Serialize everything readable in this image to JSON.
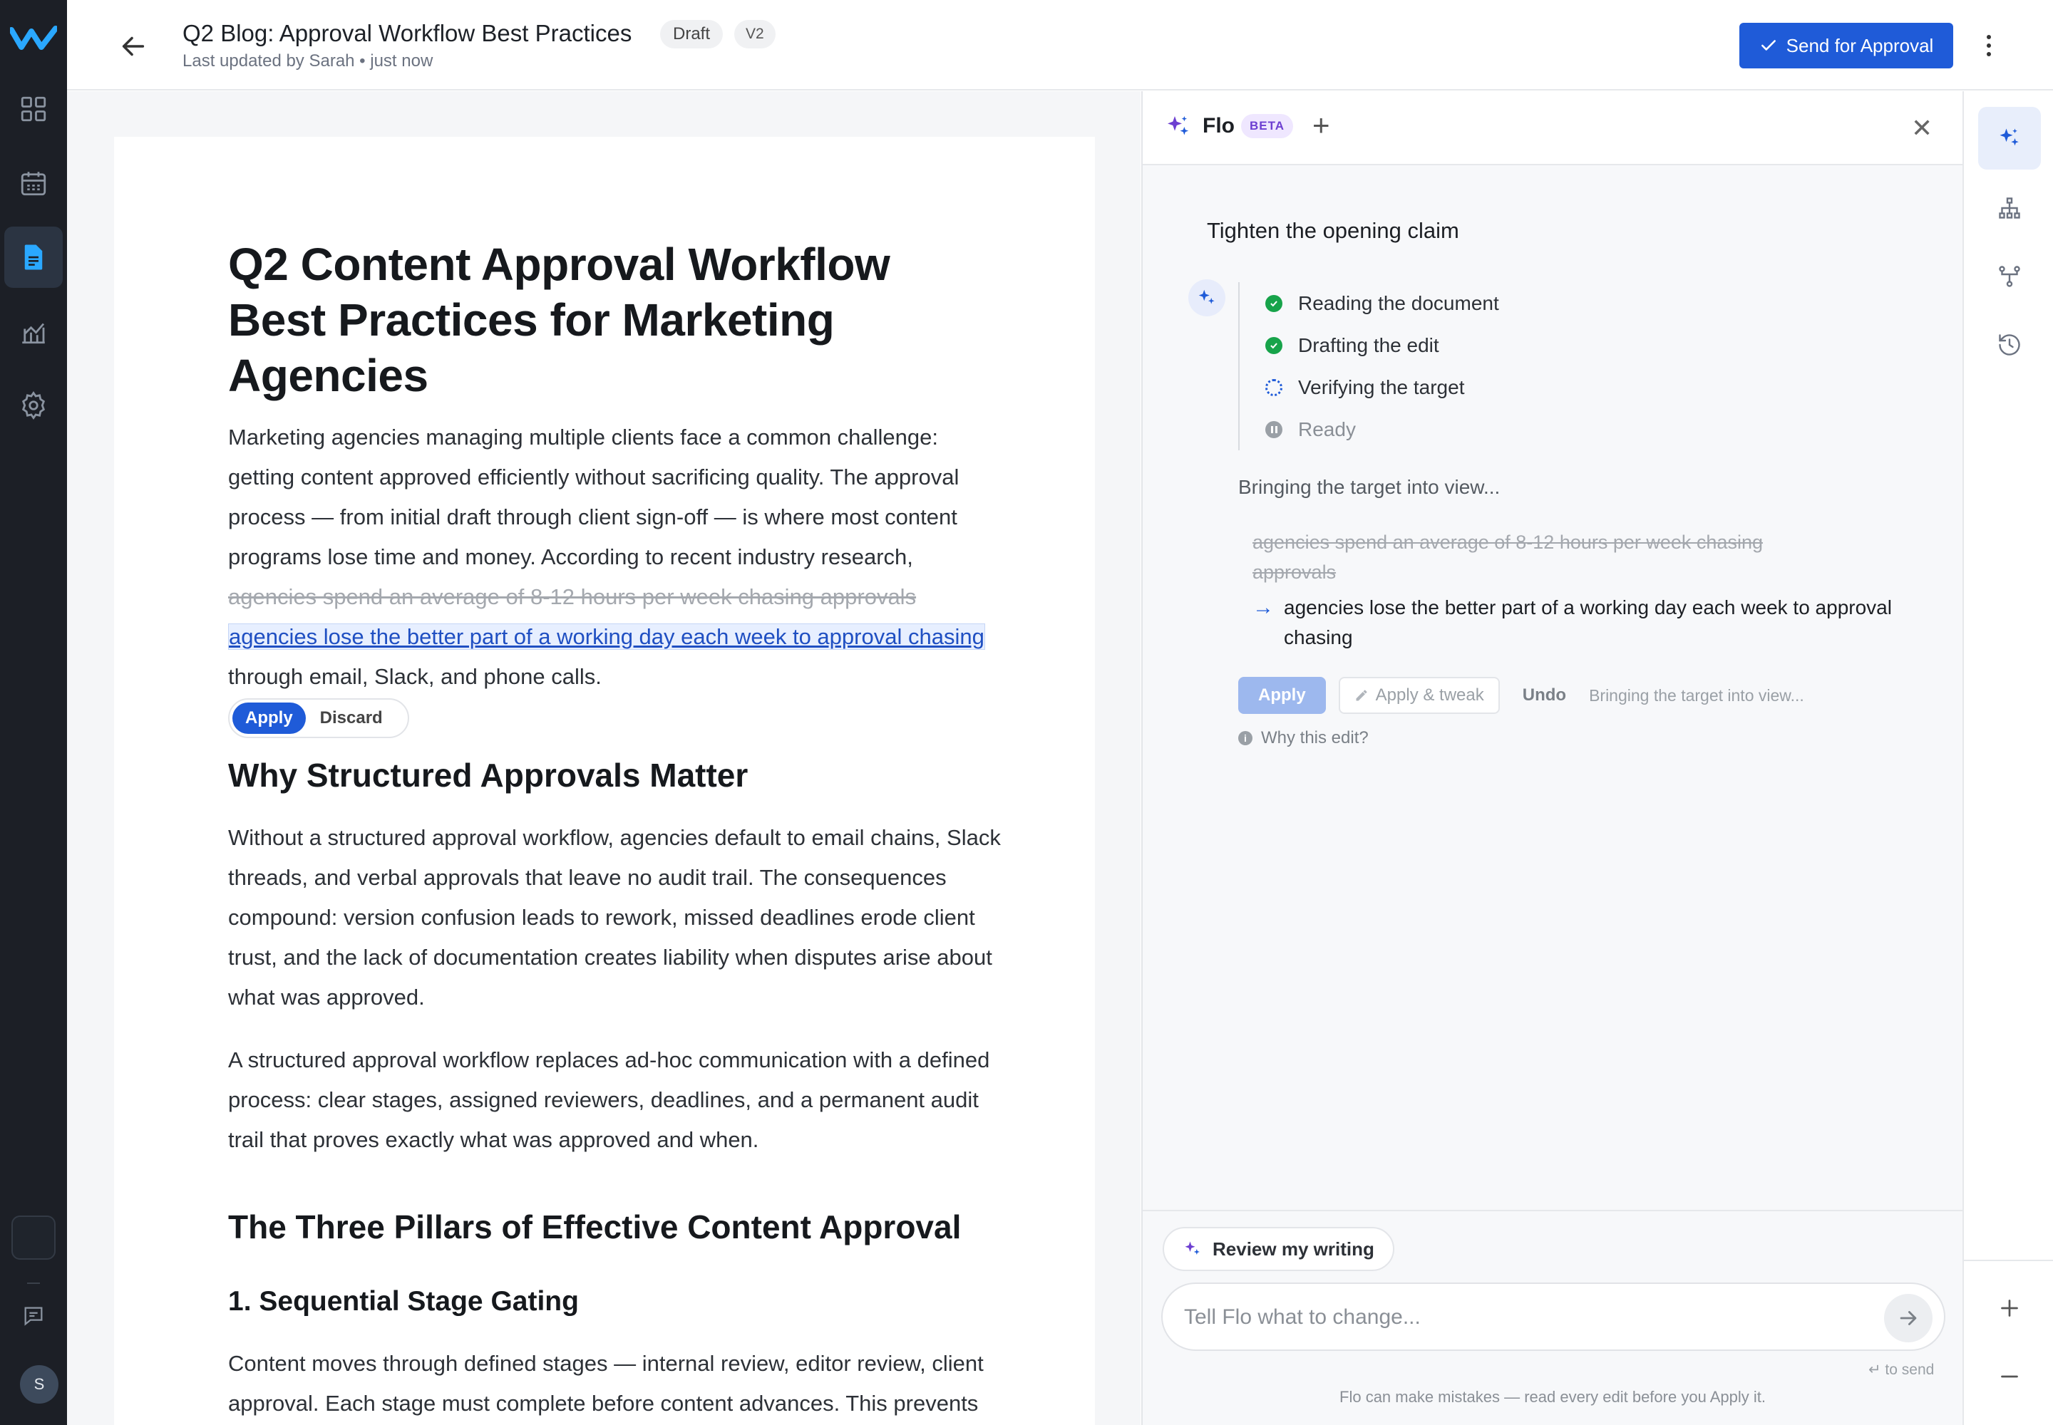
{
  "header": {
    "title": "Q2 Blog: Approval Workflow Best Practices",
    "badge_draft": "Draft",
    "badge_version": "V2",
    "subtitle": "Last updated by Sarah • just now",
    "send_label": "Send for Approval"
  },
  "user": {
    "initial": "S"
  },
  "document": {
    "title": "Q2 Content Approval Workflow Best Practices for Marketing Agencies",
    "intro_before": "Marketing agencies managing multiple clients face a common challenge: getting content approved efficiently without sacrificing quality. The approval process — from initial draft through client sign-off — is where most content programs lose time and money. According to recent industry research, ",
    "intro_removed": "agencies spend an average of 8-12 hours per week chasing approvals",
    "intro_inserted": "agencies lose the better part of a working day each week to approval chasing",
    "intro_after": " through email, Slack, and phone calls.",
    "inline_apply": "Apply",
    "inline_discard": "Discard",
    "section1_heading": "Why Structured Approvals Matter",
    "section1_p1": "Without a structured approval workflow, agencies default to email chains, Slack threads, and verbal approvals that leave no audit trail. The consequences compound: version confusion leads to rework, missed deadlines erode client trust, and the lack of documentation creates liability when disputes arise about what was approved.",
    "section1_p2": "A structured approval workflow replaces ad-hoc communication with a defined process: clear stages, assigned reviewers, deadlines, and a permanent audit trail that proves exactly what was approved and when.",
    "section2_heading": "The Three Pillars of Effective Content Approval",
    "subsection1_heading": "1. Sequential Stage Gating",
    "subsection1_p": "Content moves through defined stages — internal review, editor review, client approval. Each stage must complete before content advances. This prevents the common scenario where a client receives content that"
  },
  "flo": {
    "name": "Flo",
    "beta": "BETA",
    "prompt": "Tighten the opening claim",
    "steps": [
      {
        "label": "Reading the document",
        "state": "done"
      },
      {
        "label": "Drafting the edit",
        "state": "done"
      },
      {
        "label": "Verifying the target",
        "state": "running"
      },
      {
        "label": "Ready",
        "state": "pending"
      }
    ],
    "bringing": "Bringing the target into view...",
    "diff_old": "agencies spend an average of 8-12 hours per week chasing approvals",
    "diff_new": "agencies lose the better part of a working day each week to approval chasing",
    "apply": "Apply",
    "apply_tweak": "Apply & tweak",
    "undo": "Undo",
    "status": "Bringing the target into view...",
    "why": "Why this edit?",
    "review_label": "Review my writing",
    "input_placeholder": "Tell Flo what to change...",
    "to_send": "↵ to send",
    "disclaimer": "Flo can make mistakes — read every edit before you Apply it."
  },
  "colors": {
    "accent": "#1f5bd8",
    "nav_bg": "#1c1f26",
    "success": "#17a34a",
    "beta_bg": "#efe7ff"
  }
}
